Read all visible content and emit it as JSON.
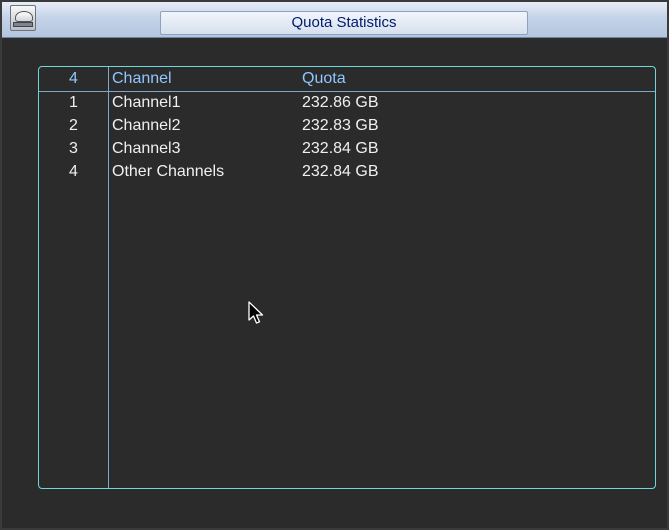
{
  "window": {
    "title": "Quota Statistics"
  },
  "table": {
    "header": {
      "index": "4",
      "channel": "Channel",
      "quota": "Quota"
    },
    "rows": [
      {
        "index": "1",
        "channel": "Channel1",
        "quota": "232.86 GB"
      },
      {
        "index": "2",
        "channel": "Channel2",
        "quota": "232.83 GB"
      },
      {
        "index": "3",
        "channel": "Channel3",
        "quota": "232.84 GB"
      },
      {
        "index": "4",
        "channel": "Other Channels",
        "quota": "232.84 GB"
      }
    ]
  },
  "icons": {
    "title_icon": "hard-disk-icon",
    "cursor": "mouse-pointer-icon"
  },
  "colors": {
    "background": "#2b2b2b",
    "table_border": "#6fd7dc",
    "header_text": "#8fc7ff",
    "row_text": "#f0f0f0",
    "title_text": "#001a6e"
  }
}
